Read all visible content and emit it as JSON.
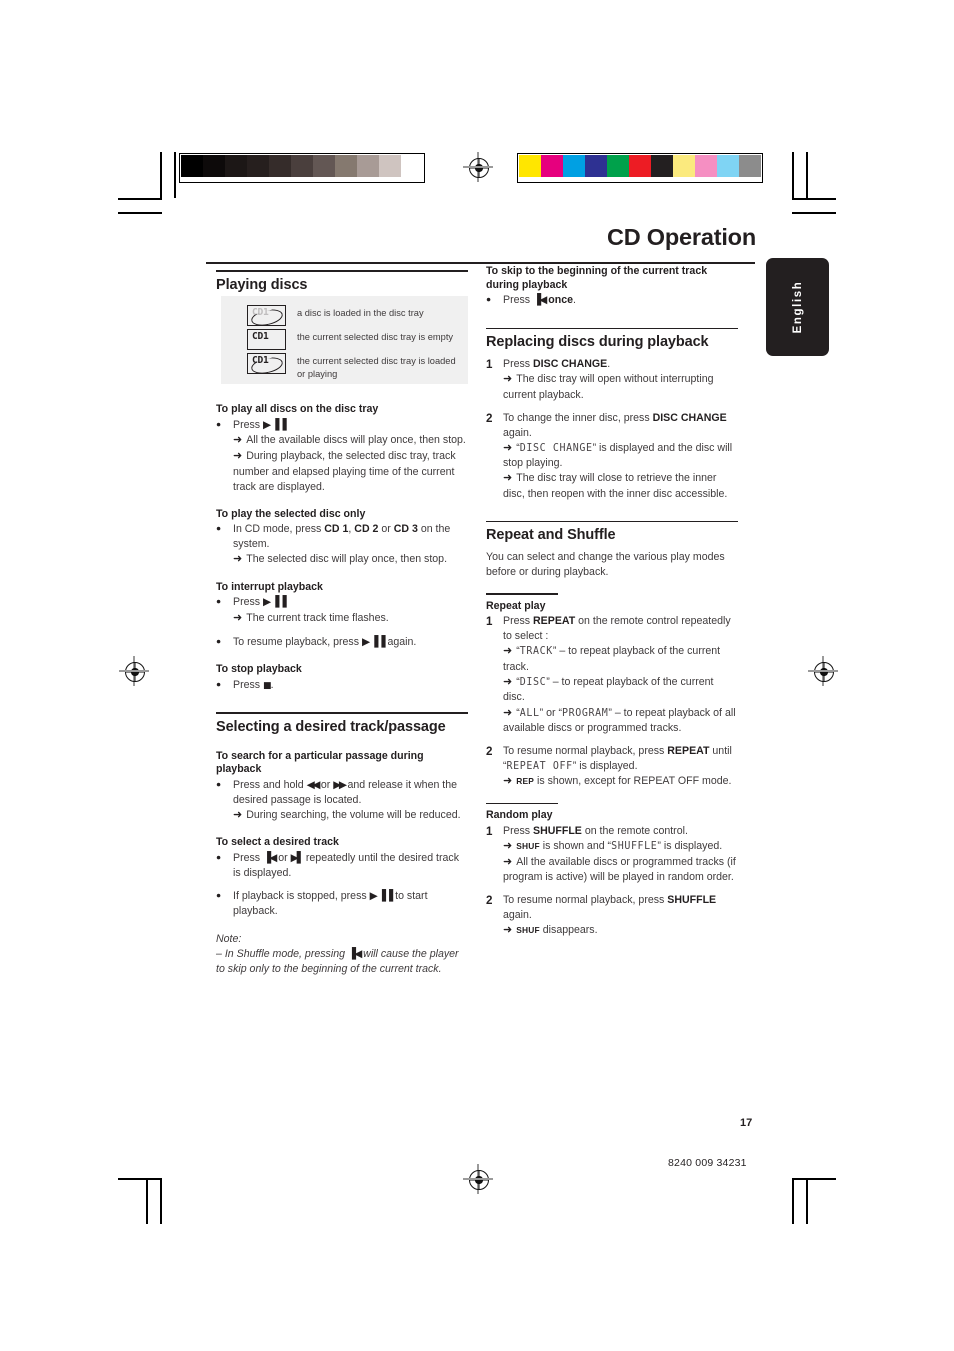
{
  "document": {
    "title": "CD Operation",
    "language_tab": "English",
    "page_number": "17",
    "part_number": "8240 009 34231"
  },
  "calibration": {
    "grayscale": [
      "#000000",
      "#0d0a0a",
      "#1c1716",
      "#261f1e",
      "#352c2a",
      "#4a3f3d",
      "#635754",
      "#85796f",
      "#a89b96",
      "#cfc4c0",
      "#ffffff"
    ],
    "colors": [
      "#ffe600",
      "#e6007e",
      "#00a0e3",
      "#2e3192",
      "#00a14b",
      "#ed1c24",
      "#231f20",
      "#fbea7e",
      "#f58fc2",
      "#7fd4f4",
      "#8c8c8c"
    ]
  },
  "legend": {
    "items": [
      {
        "icon": "disc-loaded-icon",
        "display": "CD1",
        "text": "a disc is loaded in the disc tray"
      },
      {
        "icon": "disc-empty-icon",
        "display": "CD1",
        "text": "the current selected disc tray is empty"
      },
      {
        "icon": "disc-selected-loaded-icon",
        "display": "CD1",
        "text": "the current selected disc tray is loaded or playing"
      }
    ]
  },
  "left_column": {
    "section_title": "Playing discs",
    "blocks": [
      {
        "heading": "To play all discs on the disc tray",
        "bullet": "Press",
        "glyph": "play-pause",
        "arrows": [
          "All the available discs will play once, then stop.",
          "During playback, the selected disc tray, track number and elapsed playing time of the current track are displayed."
        ]
      },
      {
        "heading": "To play the selected disc only",
        "bullet_pre": "In CD mode, press ",
        "cd1": "CD 1",
        "sep1": ", ",
        "cd2": "CD 2",
        "sep2": " or ",
        "cd3": "CD 3",
        "bullet_post": " on the system.",
        "arrows": [
          "The selected disc will play once, then stop."
        ]
      },
      {
        "heading": "To interrupt playback",
        "bullet": "Press",
        "arrows": [
          "The current track time flashes."
        ],
        "bullet2_pre": "To resume playback, press ",
        "bullet2_post": " again."
      },
      {
        "heading": "To stop playback",
        "bullet": "Press",
        "period": "."
      }
    ],
    "section_title_2": "Selecting a desired track/passage",
    "blocks_2": [
      {
        "heading": "To search for a particular passage during playback",
        "pre": "Press and hold ",
        "mid": " or ",
        "post": " and release it when the desired passage is located.",
        "arrows": [
          "During searching, the volume will be reduced."
        ]
      },
      {
        "heading": "To select a desired track",
        "pre": "Press ",
        "mid": " or ",
        "post": " repeatedly until the desired track is displayed.",
        "bullet2_pre": "If playback is stopped, press ",
        "bullet2_post": " to start playback."
      }
    ],
    "note": {
      "label": "Note:",
      "dash": "– ",
      "pre": "In Shuffle mode, pressing ",
      "post": " will cause the player to skip only to the beginning of the current track."
    }
  },
  "right_column": {
    "skip": {
      "heading": "To skip to the beginning of the current track during playback",
      "pre": "Press ",
      "post": "once",
      "period": "."
    },
    "replacing": {
      "section_title": "Replacing discs during playback",
      "steps": [
        {
          "num": "1",
          "pre": "Press ",
          "bold": "DISC CHANGE",
          "post": ".",
          "arrows": [
            "The disc tray will open without interrupting current playback."
          ]
        },
        {
          "num": "2",
          "pre": "To change the inner disc, press ",
          "bold": "DISC CHANGE",
          "post": " again.",
          "arrow_lcd_pre": "“",
          "arrow_lcd": "DISC CHANGE",
          "arrow_lcd_post": "” is displayed and the disc will stop playing.",
          "arrows": [
            "The disc tray will close to retrieve the inner disc, then reopen with the inner disc accessible."
          ]
        }
      ]
    },
    "repeat_shuffle": {
      "section_title": "Repeat and Shuffle",
      "intro": "You can select and change the various play modes before or during playback.",
      "repeat": {
        "sub_title": "Repeat play",
        "step1": {
          "num": "1",
          "pre": "Press ",
          "bold": "REPEAT",
          "post": " on the remote control repeatedly to select :",
          "options": [
            {
              "lcd": "TRACK",
              "text": " – to repeat playback of the current track."
            },
            {
              "lcd": "DISC",
              "text": " – to repeat playback of the current disc."
            },
            {
              "lcd": "ALL",
              "lcd2": "PROGRAM",
              "joiner": " or ",
              "text": " – to repeat playback of all available discs or programmed tracks."
            }
          ]
        },
        "step2": {
          "num": "2",
          "pre": "To resume normal playback, press ",
          "bold": "REPEAT",
          "post_pre": " until “",
          "lcd": "REPEAT OFF",
          "post": "” is displayed.",
          "arrow_icon": "REP",
          "arrow_text": " is shown, except for REPEAT OFF mode."
        }
      },
      "random": {
        "sub_title": "Random play",
        "step1": {
          "num": "1",
          "pre": "Press ",
          "bold": "SHUFFLE",
          "post": " on the remote control.",
          "arrow1_icon": "SHUF",
          "arrow1_pre": " is shown and “",
          "arrow1_lcd": "SHUFFLE",
          "arrow1_post": "” is displayed.",
          "arrow2": "All the available discs or programmed tracks (if program is active) will be played in random order."
        },
        "step2": {
          "num": "2",
          "pre": "To resume normal playback, press ",
          "bold": "SHUFFLE",
          "post": " again.",
          "arrow_icon": "SHUF",
          "arrow_text": " disappears."
        }
      }
    }
  }
}
